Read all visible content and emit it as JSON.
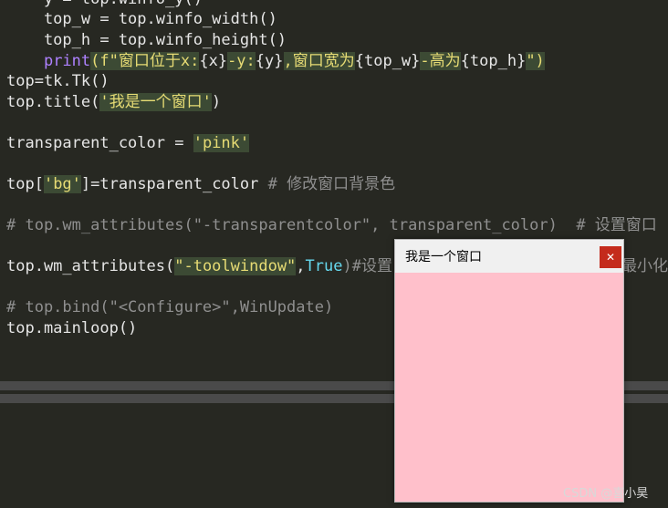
{
  "code": {
    "line0_prefix": "    y = top.winfo_y()",
    "line1": "    top_w = top.winfo_width()",
    "line2": "    top_h = top.winfo_height()",
    "line3_print": "print",
    "line3_open": "(f\"",
    "line3_str1": "窗口位于x:",
    "line3_var1": "{x}",
    "line3_str2": "-y:",
    "line3_var2": "{y}",
    "line3_str3": ",窗口宽为",
    "line3_var3": "{top_w}",
    "line3_str4": "-高为",
    "line3_var4": "{top_h}",
    "line3_close": "\")",
    "line4": "top=tk.Tk()",
    "line5_prefix": "top.title(",
    "line5_str": "'我是一个窗口'",
    "line5_suffix": ")",
    "line6_prefix": "transparent_color = ",
    "line6_str": "'pink'",
    "line7_prefix": "top[",
    "line7_str": "'bg'",
    "line7_mid": "]=transparent_color ",
    "line7_comment": "# 修改窗口背景色",
    "line8_comment": "# top.wm_attributes(\"-transparentcolor\", transparent_color)  # 设置窗口",
    "line9_prefix": "top.wm_attributes(",
    "line9_str": "\"-toolwindow\"",
    "line9_comma": ",",
    "line9_true": "True",
    "line9_comment": ")#设置",
    "line9_tail": "最小化",
    "line10_comment": "# top.bind(\"<Configure>\",WinUpdate)",
    "line11": "top.mainloop()"
  },
  "tk_window": {
    "title": "我是一个窗口",
    "close_glyph": "✕"
  },
  "watermark": "CSDN @喜小昊",
  "colors": {
    "editor_bg": "#272822",
    "window_body": "#ffc0cb",
    "close_button": "#c42b1c"
  }
}
